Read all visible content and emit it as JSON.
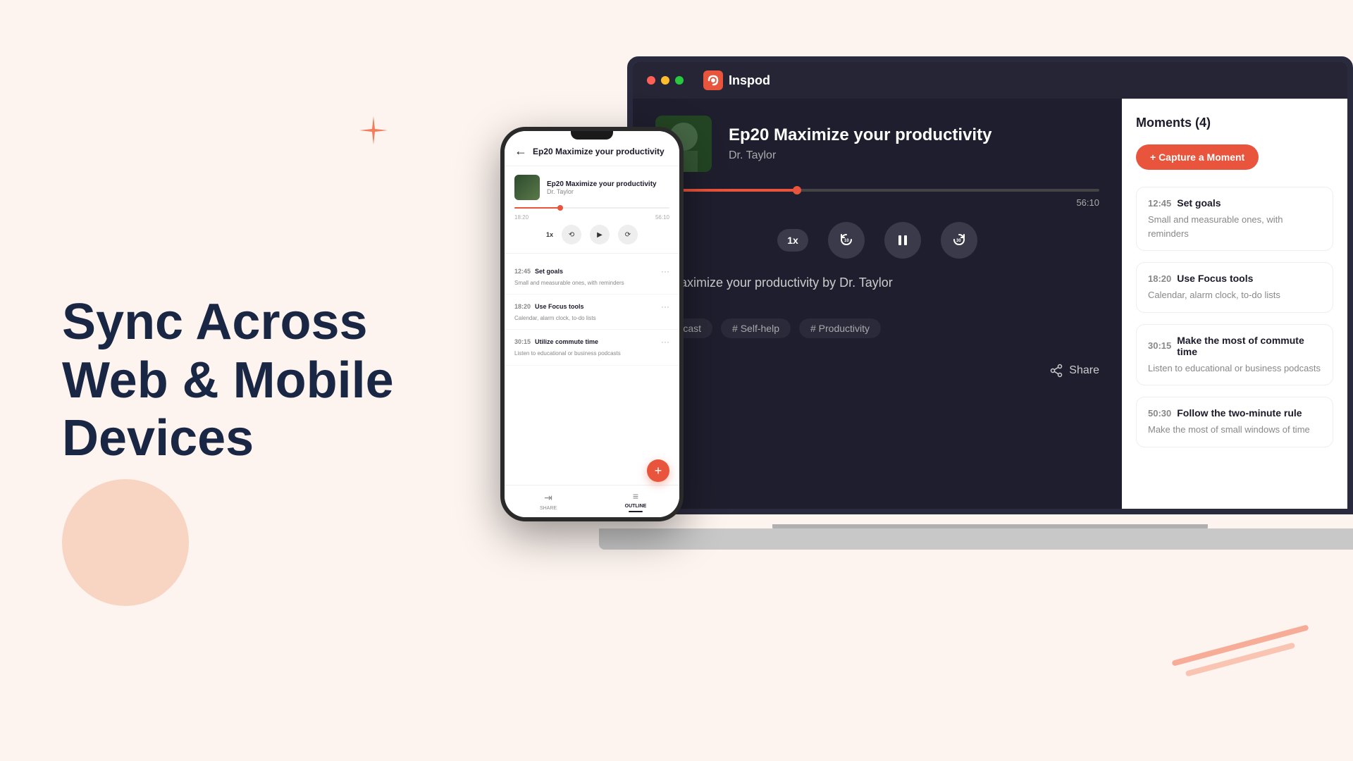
{
  "hero": {
    "title_line1": "Sync Across",
    "title_line2": "Web & Mobile",
    "title_line3": "Devices"
  },
  "app": {
    "name": "Inspod",
    "episode_title": "Ep20 Maximize your productivity",
    "author": "Dr. Taylor",
    "time_current": "18:20",
    "time_total": "56:10",
    "progress_percent": 32,
    "episode_desc": "0. Maximize your productivity by Dr. Taylor",
    "tags": [
      "# Self-help",
      "# Productivity"
    ],
    "share_label": "Share",
    "speed": "1x"
  },
  "moments": {
    "header": "Moments (4)",
    "capture_btn": "+ Capture a Moment",
    "items": [
      {
        "time": "12:45",
        "title": "Set goals",
        "desc": "Small and measurable ones, with reminders"
      },
      {
        "time": "18:20",
        "title": "Use Focus tools",
        "desc": "Calendar, alarm clock, to-do lists"
      },
      {
        "time": "30:15",
        "title": "Make the most of commute time",
        "desc": "Listen to educational or business podcasts"
      },
      {
        "time": "50:30",
        "title": "Follow the two-minute rule",
        "desc": "Make the most of small windows of time"
      }
    ]
  },
  "phone": {
    "header_title": "Ep20 Maximize your productivity",
    "mini_ep": "Ep20 Maximize your productivity",
    "mini_author": "Dr. Taylor",
    "time_current": "18:20",
    "time_total": "56:10",
    "speed": "1x",
    "moments": [
      {
        "time": "12:45",
        "title": "Set goals",
        "desc": "Small and measurable ones, with reminders"
      },
      {
        "time": "18:20",
        "title": "Use Focus tools",
        "desc": "Calendar, alarm clock, to-do lists"
      },
      {
        "time": "30:15",
        "title": "Utilize commute time",
        "desc": "Listen to educational or business podcasts"
      }
    ],
    "nav_share": "SHARE",
    "nav_outline": "OUTLINE"
  }
}
